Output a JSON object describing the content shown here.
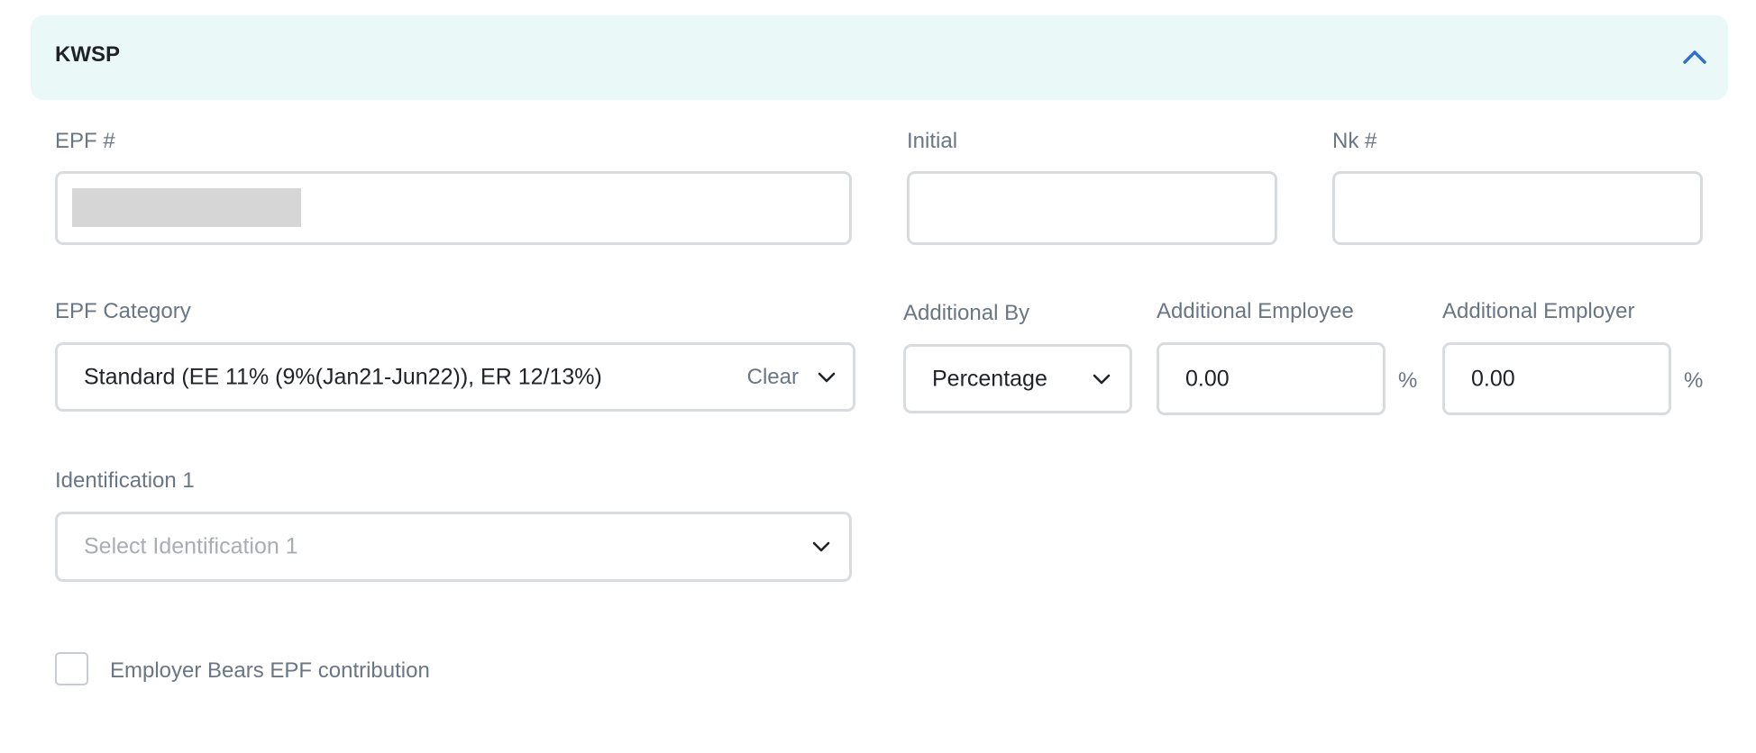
{
  "section": {
    "title": "KWSP",
    "collapse_icon": "chevron-up-icon",
    "accent_color": "#2f6fd1",
    "background": "#ebf8f8"
  },
  "fields": {
    "epf_number": {
      "label": "EPF #",
      "value": ""
    },
    "initial": {
      "label": "Initial",
      "value": ""
    },
    "nk_number": {
      "label": "Nk #",
      "value": ""
    },
    "epf_category": {
      "label": "EPF Category",
      "value": "Standard (EE 11% (9%(Jan21-Jun22)), ER 12/13%)",
      "clear_label": "Clear"
    },
    "additional_by": {
      "label": "Additional By",
      "value": "Percentage"
    },
    "additional_employee": {
      "label": "Additional Employee",
      "value": "0.00",
      "unit": "%"
    },
    "additional_employer": {
      "label": "Additional Employer",
      "value": "0.00",
      "unit": "%"
    },
    "identification_1": {
      "label": "Identification 1",
      "placeholder": "Select Identification 1"
    }
  },
  "checkbox": {
    "label": "Employer Bears EPF contribution",
    "checked": false
  }
}
